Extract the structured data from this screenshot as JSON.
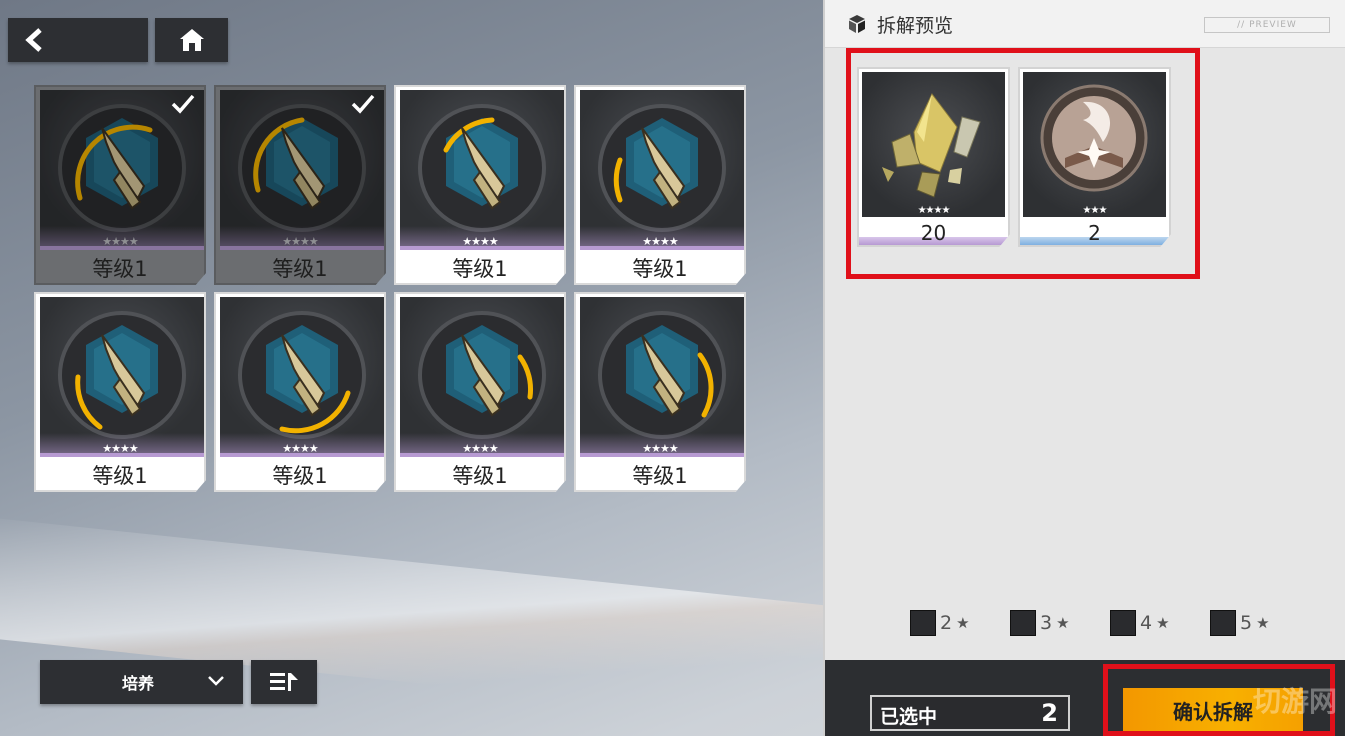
{
  "nav": {
    "back_icon": "chevron-left-icon",
    "home_icon": "home-icon"
  },
  "items": [
    {
      "level": "等级1",
      "stars": "★★★★",
      "selected": true
    },
    {
      "level": "等级1",
      "stars": "★★★★",
      "selected": true
    },
    {
      "level": "等级1",
      "stars": "★★★★",
      "selected": false
    },
    {
      "level": "等级1",
      "stars": "★★★★",
      "selected": false
    },
    {
      "level": "等级1",
      "stars": "★★★★",
      "selected": false
    },
    {
      "level": "等级1",
      "stars": "★★★★",
      "selected": false
    },
    {
      "level": "等级1",
      "stars": "★★★★",
      "selected": false
    },
    {
      "level": "等级1",
      "stars": "★★★★",
      "selected": false
    }
  ],
  "controls": {
    "filter_label": "培养",
    "sort_icon": "sort-icon"
  },
  "panel": {
    "title": "拆解预览",
    "preview_tag": "// PREVIEW",
    "rewards": [
      {
        "name": "crystal-shards",
        "stars": "★★★★",
        "quantity": "20",
        "rarity_color": "#b79ad2"
      },
      {
        "name": "book-emblem",
        "stars": "★★★",
        "quantity": "2",
        "rarity_color": "#7fb0e0"
      }
    ],
    "rarity_filters": [
      {
        "value": "2",
        "star": "★"
      },
      {
        "value": "3",
        "star": "★"
      },
      {
        "value": "4",
        "star": "★"
      },
      {
        "value": "5",
        "star": "★"
      }
    ],
    "selected_label": "已选中",
    "selected_count": "2",
    "confirm_label": "确认拆解",
    "watermark": "切游网"
  },
  "colors": {
    "highlight": "#e0101a",
    "confirm": "#f8b000",
    "rarity_purple": "#b79ad2",
    "rarity_blue": "#7fb0e0"
  }
}
